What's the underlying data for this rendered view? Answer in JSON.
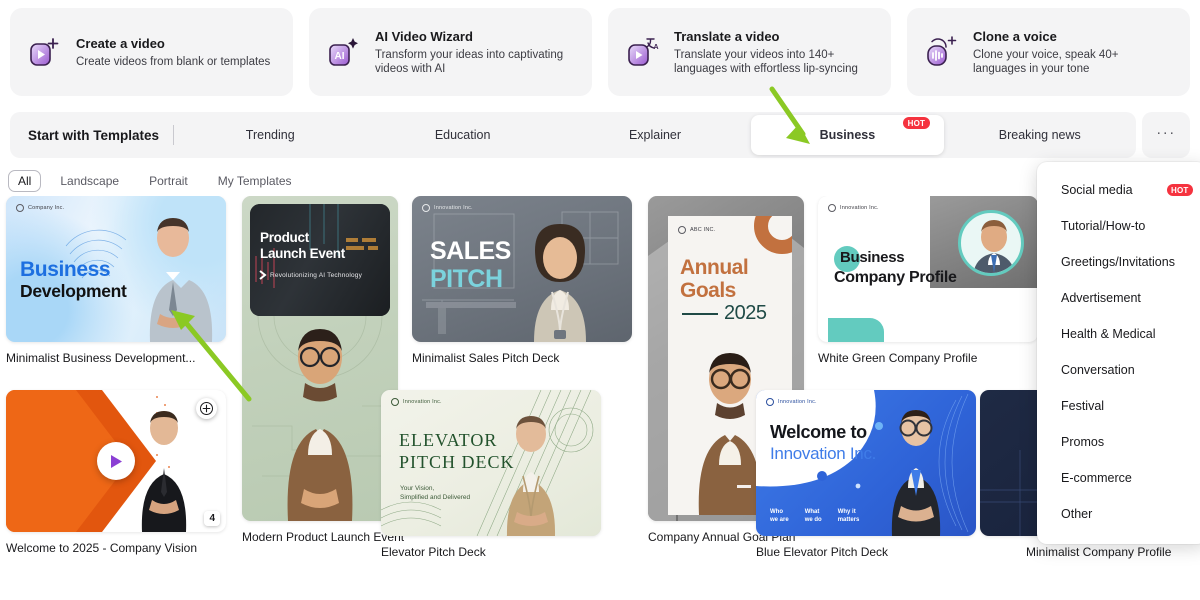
{
  "colors": {
    "accent_purple": "#8b3fd4",
    "hot_red": "#f5333f",
    "card_bg": "#f4f4f5",
    "annotation_green": "#8bc924"
  },
  "top_cards": [
    {
      "icon": "create-video-icon",
      "title": "Create a video",
      "subtitle": "Create videos from blank or templates"
    },
    {
      "icon": "ai-video-wizard-icon",
      "title": "AI Video Wizard",
      "subtitle": "Transform your ideas into captivating videos with AI"
    },
    {
      "icon": "translate-video-icon",
      "title": "Translate a video",
      "subtitle": "Translate your videos into 140+ languages with effortless lip-syncing"
    },
    {
      "icon": "clone-voice-icon",
      "title": "Clone a voice",
      "subtitle": "Clone your voice, speak 40+ languages in your tone"
    }
  ],
  "tabbar": {
    "section_label": "Start with Templates",
    "more_label": "···",
    "tabs": [
      {
        "label": "Trending",
        "active": false,
        "badge": ""
      },
      {
        "label": "Education",
        "active": false,
        "badge": ""
      },
      {
        "label": "Explainer",
        "active": false,
        "badge": ""
      },
      {
        "label": "Business",
        "active": true,
        "badge": "HOT"
      },
      {
        "label": "Breaking news",
        "active": false,
        "badge": ""
      }
    ]
  },
  "dropdown": {
    "items": [
      {
        "label": "Social media",
        "badge": "HOT"
      },
      {
        "label": "Tutorial/How-to",
        "badge": ""
      },
      {
        "label": "Greetings/Invitations",
        "badge": ""
      },
      {
        "label": "Advertisement",
        "badge": ""
      },
      {
        "label": "Health & Medical",
        "badge": ""
      },
      {
        "label": "Conversation",
        "badge": ""
      },
      {
        "label": "Festival",
        "badge": ""
      },
      {
        "label": "Promos",
        "badge": ""
      },
      {
        "label": "E-commerce",
        "badge": ""
      },
      {
        "label": "Other",
        "badge": ""
      }
    ]
  },
  "filters": [
    {
      "label": "All",
      "active": true
    },
    {
      "label": "Landscape",
      "active": false
    },
    {
      "label": "Portrait",
      "active": false
    },
    {
      "label": "My Templates",
      "active": false
    }
  ],
  "scroll_arrow": {
    "glyph": "›"
  },
  "templates": {
    "row1": [
      {
        "caption": "Minimalist Business Development...",
        "orientation": "landscape",
        "thumb_brand": "Company Inc.",
        "thumb_title_line1": "Business",
        "thumb_title_line2": "Development"
      },
      {
        "caption": "Modern Product Launch Event",
        "orientation": "portrait",
        "thumb_title_line1": "Product",
        "thumb_title_line2": "Launch Event",
        "thumb_subtitle": "Revolutionizing AI Technology"
      },
      {
        "caption": "Minimalist Sales Pitch Deck",
        "orientation": "landscape",
        "thumb_brand": "Innovation Inc.",
        "thumb_title_line1": "SALES",
        "thumb_title_line2": "PITCH"
      },
      {
        "caption": "Company Annual Goal Plan",
        "orientation": "portrait",
        "thumb_brand": "ABC INC.",
        "thumb_title_line1": "Annual",
        "thumb_title_line2": "Goals",
        "thumb_year": "2025"
      },
      {
        "caption": "White Green Company Profile",
        "orientation": "landscape",
        "thumb_brand": "Innovation Inc.",
        "thumb_title_line1": "Business",
        "thumb_title_line2": "Company Profile"
      }
    ],
    "row2": [
      {
        "caption": "Welcome to 2025 - Company Vision",
        "orientation": "landscape",
        "hovered": true,
        "add_label": "+",
        "count_badge": "4",
        "play_label": "play-icon"
      },
      {
        "caption": "Elevator Pitch Deck",
        "orientation": "landscape",
        "thumb_brand": "Innovation Inc.",
        "thumb_title_line1": "ELEVATOR",
        "thumb_title_line2": "PITCH DECK",
        "thumb_subtitle_line1": "Your Vision,",
        "thumb_subtitle_line2": "Simplified and Delivered"
      },
      {
        "caption": "Blue Elevator Pitch Deck",
        "orientation": "landscape",
        "thumb_brand": "Innovation Inc.",
        "thumb_title_line1": "Welcome to",
        "thumb_title_line2": "Innovation Inc.",
        "thumb_tag1_l1": "Who",
        "thumb_tag1_l2": "we are",
        "thumb_tag2_l1": "What",
        "thumb_tag2_l2": "we do",
        "thumb_tag3_l1": "Why it",
        "thumb_tag3_l2": "matters"
      },
      {
        "caption": "Minimalist Company Profile",
        "orientation": "landscape"
      }
    ]
  }
}
